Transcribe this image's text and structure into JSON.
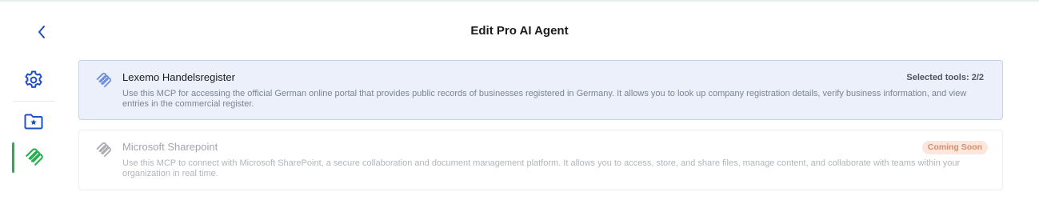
{
  "header": {
    "title": "Edit Pro AI Agent"
  },
  "sidebar": {
    "items": [
      {
        "icon": "gear-icon",
        "active": false
      },
      {
        "icon": "folder-star-icon",
        "active": false
      },
      {
        "icon": "paperclip-icon",
        "active": true
      }
    ]
  },
  "mcps": [
    {
      "name": "Lexemo Handelsregister",
      "description": "Use this MCP for accessing the official German online portal that provides public records of businesses registered in Germany. It allows you to look up company registration details, verify business information, and view entries in the commercial register.",
      "status": "Selected tools: 2/2"
    },
    {
      "name": "Microsoft Sharepoint",
      "description": "Use this MCP to connect with Microsoft SharePoint, a secure collaboration and document management platform. It allows you to access, store, and share files, manage content, and collaborate with teams within your organization in real time.",
      "status": "Coming Soon"
    }
  ],
  "colors": {
    "accent_blue": "#1f4fc4",
    "active_green": "#23b14d",
    "selected_bg": "#ebf0fb",
    "badge_bg": "#fde6dc",
    "badge_text": "#d98d6e"
  }
}
